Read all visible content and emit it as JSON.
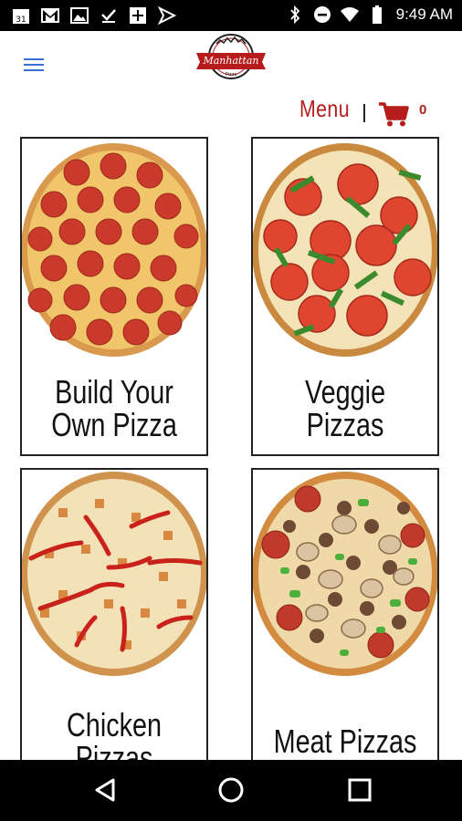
{
  "status_bar": {
    "time": "9:49 AM",
    "icons": [
      "calendar-icon",
      "gmail-icon",
      "gallery-icon",
      "download-done-icon",
      "add-box-icon",
      "send-icon",
      "bluetooth-icon",
      "do-not-disturb-icon",
      "wifi-icon",
      "battery-icon"
    ]
  },
  "header": {
    "logo_text": "Manhattan",
    "logo_subtext": "Pizza"
  },
  "menu_row": {
    "menu_label": "Menu",
    "cart_count": "0"
  },
  "categories": [
    {
      "title": "Build Your\nOwn Pizza",
      "pizza": "pepperoni"
    },
    {
      "title": "Veggie\nPizzas",
      "pizza": "veggie"
    },
    {
      "title": "Chicken\nPizzas",
      "pizza": "chicken"
    },
    {
      "title": "Meat Pizzas",
      "pizza": "meat"
    }
  ],
  "colors": {
    "brand_red": "#b71c1c",
    "hamburger_blue": "#3b6fd6"
  }
}
